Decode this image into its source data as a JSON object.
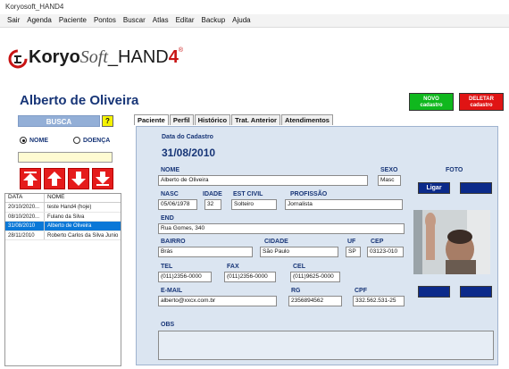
{
  "window": {
    "title": "Koryosoft_HAND4"
  },
  "menu": [
    "Sair",
    "Agenda",
    "Paciente",
    "Pontos",
    "Buscar",
    "Atlas",
    "Editar",
    "Backup",
    "Ajuda"
  ],
  "logo": {
    "part1": "Koryo",
    "part2": "Soft",
    "part3": "_HAND",
    "part4": "4",
    "reg": "®"
  },
  "patient": {
    "name": "Alberto de Oliveira"
  },
  "actions": {
    "novo": "NOVO",
    "novo_sub": "cadastro",
    "deletar": "DELETAR",
    "deletar_sub": "cadastro"
  },
  "search": {
    "title": "BUSCA",
    "help": "?",
    "radio_nome": "NOME",
    "radio_doenca": "DOENÇA",
    "selected": "NOME",
    "value": ""
  },
  "list": {
    "headers": [
      "DATA",
      "NOME"
    ],
    "rows": [
      {
        "date": "20/10/2020...",
        "name": "teste Hand4 (hoje)"
      },
      {
        "date": "08/10/2020...",
        "name": "Fulano da Silva"
      },
      {
        "date": "31/08/2010",
        "name": "Alberto de Oliveira",
        "selected": true
      },
      {
        "date": "28/11/2010",
        "name": "Roberto Carlos da Silva Junio"
      }
    ]
  },
  "tabs": [
    "Paciente",
    "Perfil",
    "Histórico",
    "Trat. Anterior",
    "Atendimentos"
  ],
  "active_tab": "Paciente",
  "form": {
    "data_cadastro_label": "Data do Cadastro",
    "data_cadastro": "31/08/2010",
    "nome_label": "NOME",
    "nome": "Alberto de Oliveira",
    "sexo_label": "SEXO",
    "sexo": "Masc",
    "foto_label": "FOTO",
    "ligar": "Ligar",
    "nasc_label": "NASC",
    "nasc": "05/06/1978",
    "idade_label": "IDADE",
    "idade": "32",
    "est_civil_label": "EST CIVIL",
    "est_civil": "Solteiro",
    "profissao_label": "PROFISSÃO",
    "profissao": "Jornalista",
    "end_label": "END",
    "end": "Rua Gomes, 340",
    "bairro_label": "BAIRRO",
    "bairro": "Brás",
    "cidade_label": "CIDADE",
    "cidade": "São Paulo",
    "uf_label": "UF",
    "uf": "SP",
    "cep_label": "CEP",
    "cep": "03123-010",
    "tel_label": "TEL",
    "tel": "(011)2356-0000",
    "fax_label": "FAX",
    "fax": "(011)2356-0000",
    "cel_label": "CEL",
    "cel": "(011)9625-0000",
    "email_label": "E-MAIL",
    "email": "alberto@xxcx.com.br",
    "rg_label": "RG",
    "rg": "2356894562",
    "cpf_label": "CPF",
    "cpf": "332.562.531-25",
    "obs_label": "OBS",
    "obs": ""
  },
  "colors": {
    "accent": "#173577",
    "panel": "#dbe5f1",
    "novo": "#10b81e",
    "deletar": "#e01414",
    "selection": "#0a78d7"
  }
}
